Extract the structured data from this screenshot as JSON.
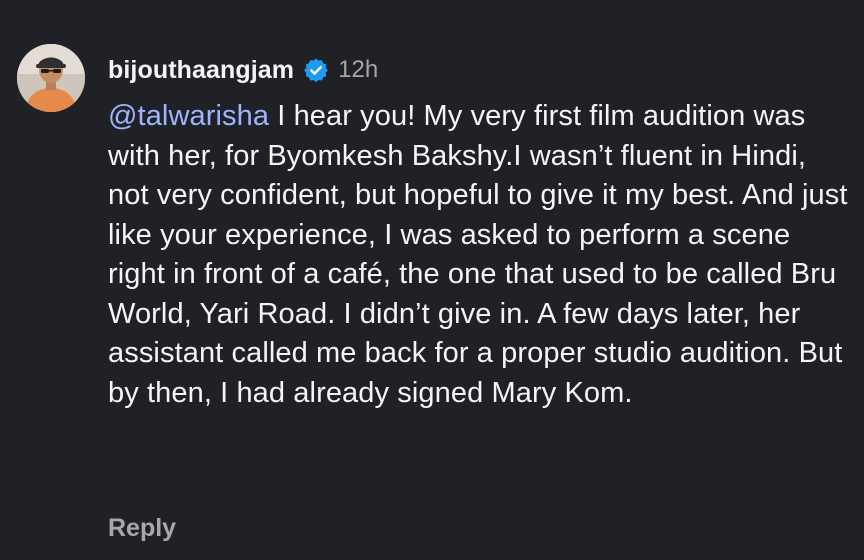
{
  "comment": {
    "avatar_icon": "profile-photo",
    "username": "bijouthaangjam",
    "verified_icon": "verified-badge-icon",
    "verified_color": "#1d9bf0",
    "timestamp": "12h",
    "mention": "@talwarisha",
    "text": " I hear you! My very first film audition was with her, for Byomkesh Bakshy.I wasn’t fluent in Hindi, not very confident, but hopeful to give it my best. And just like your experience, I was asked to perform a scene right in front of a café, the one that used to be called Bru World, Yari Road. I didn’t give in. A few days later, her assistant called me back for a proper studio audition. But by then, I had already signed Mary Kom.",
    "mention_color": "#9fb4ff",
    "reply_label": "Reply"
  },
  "theme": {
    "background": "#202126",
    "text": "#f5f5f5",
    "muted": "#a8a8a8"
  }
}
